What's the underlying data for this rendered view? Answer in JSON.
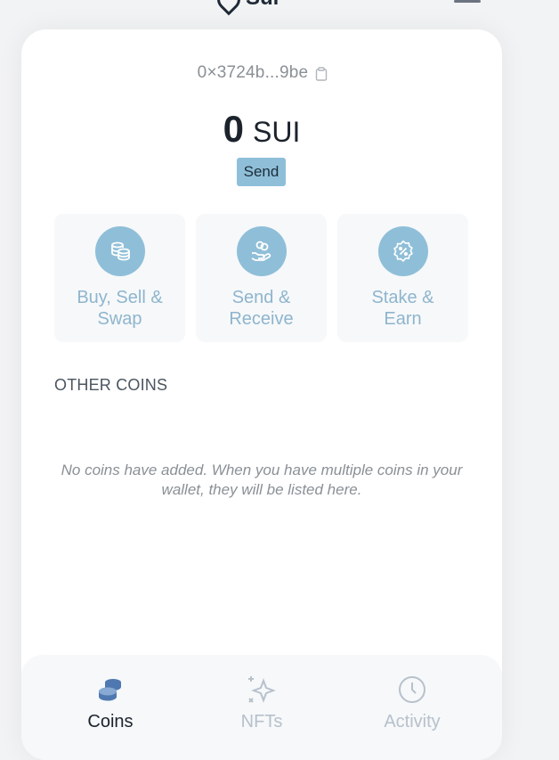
{
  "app": {
    "logo_text": "Sui"
  },
  "wallet": {
    "address": "0×3724b...9be",
    "balance_amount": "0",
    "balance_unit": "SUI"
  },
  "buttons": {
    "send_label": "Send"
  },
  "actions": [
    {
      "label_line1": "Buy, Sell &",
      "label_line2": "Swap",
      "icon": "coins-stack-icon"
    },
    {
      "label_line1": "Send &",
      "label_line2": "Receive",
      "icon": "hand-coins-icon"
    },
    {
      "label_line1": "Stake &",
      "label_line2": "Earn",
      "icon": "percent-badge-icon"
    }
  ],
  "other_coins": {
    "title": "OTHER COINS",
    "empty_message": "No coins have added. When you have multiple coins in your wallet, they will be listed here."
  },
  "bottom_nav": [
    {
      "label": "Coins",
      "icon": "coins-icon",
      "active": true
    },
    {
      "label": "NFTs",
      "icon": "sparkles-icon",
      "active": false
    },
    {
      "label": "Activity",
      "icon": "clock-icon",
      "active": false
    }
  ],
  "colors": {
    "accent": "#8fbfd8",
    "active_nav": "#4f78b0",
    "inactive_nav": "#b7c1cb",
    "text_dark": "#1c232c"
  }
}
